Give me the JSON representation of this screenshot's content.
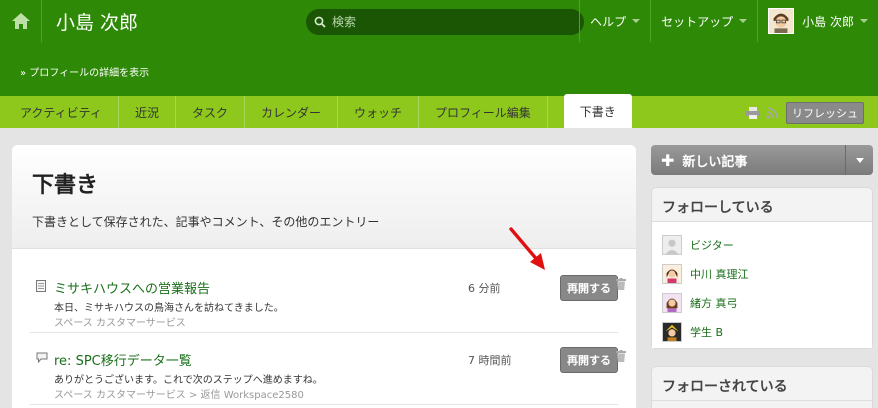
{
  "header": {
    "user_title": "小島 次郎",
    "search_placeholder": "検索",
    "nav": [
      {
        "label": "ヘルプ"
      },
      {
        "label": "セットアップ"
      },
      {
        "label": "小島 次郎"
      }
    ]
  },
  "profile_detail_link": "» プロフィールの詳細を表示",
  "tabs": [
    {
      "label": "アクティビティ"
    },
    {
      "label": "近況"
    },
    {
      "label": "タスク"
    },
    {
      "label": "カレンダー"
    },
    {
      "label": "ウォッチ"
    },
    {
      "label": "プロフィール編集"
    },
    {
      "label": "下書き"
    }
  ],
  "refresh_label": "リフレッシュ",
  "main": {
    "title": "下書き",
    "description": "下書きとして保存された、記事やコメント、その他のエントリー",
    "entries": [
      {
        "title": "ミサキハウスへの営業報告",
        "time": "6 分前",
        "excerpt": "本日、ミサキハウスの鳥海さんを訪ねてきました。",
        "meta": "スペース カスタマーサービス",
        "resume": "再開する"
      },
      {
        "title": "re: SPC移行データ一覧",
        "time": "7 時間前",
        "excerpt": "ありがとうございます。これで次のステップへ進めますね。",
        "meta": "スペース カスタマーサービス > 返信 Workspace2580",
        "resume": "再開する"
      }
    ]
  },
  "sidebar": {
    "new_article": "新しい記事",
    "following_title": "フォローしている",
    "following": [
      {
        "name": "ビジター"
      },
      {
        "name": "中川 真理江"
      },
      {
        "name": "緒方 真弓"
      },
      {
        "name": "学生 B"
      }
    ],
    "followers_title": "フォローされている"
  },
  "colors": {
    "header_green": "#2e8a06",
    "tab_green": "#8ec81c",
    "link_green": "#1a6f1a",
    "annotation_arrow": "#e01010"
  }
}
